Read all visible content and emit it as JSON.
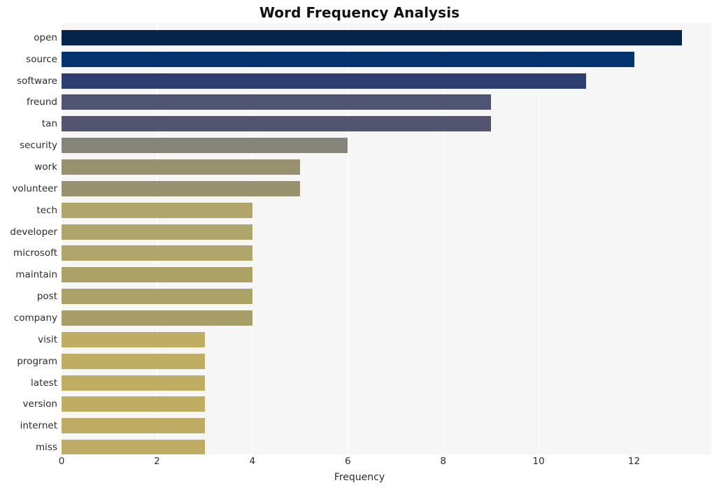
{
  "chart_data": {
    "type": "bar",
    "orientation": "horizontal",
    "title": "Word Frequency Analysis",
    "xlabel": "Frequency",
    "ylabel": "",
    "categories": [
      "open",
      "source",
      "software",
      "freund",
      "tan",
      "security",
      "work",
      "volunteer",
      "tech",
      "developer",
      "microsoft",
      "maintain",
      "post",
      "company",
      "visit",
      "program",
      "latest",
      "version",
      "internet",
      "miss"
    ],
    "values": [
      13,
      12,
      11,
      9,
      9,
      6,
      5,
      5,
      4,
      4,
      4,
      4,
      4,
      4,
      3,
      3,
      3,
      3,
      3,
      3
    ],
    "bar_colors": [
      "#042449",
      "#023370",
      "#2c3f70",
      "#4f5471",
      "#525470",
      "#868379",
      "#97916f",
      "#98926f",
      "#b0a56a",
      "#b0a56a",
      "#b0a56a",
      "#aca268",
      "#aca268",
      "#a89e68",
      "#bfad64",
      "#bfad64",
      "#bfad64",
      "#bfad64",
      "#bfac64",
      "#bfab63"
    ],
    "xticks": [
      0,
      2,
      4,
      6,
      8,
      10,
      12
    ],
    "xtick_labels": [
      "0",
      "2",
      "4",
      "6",
      "8",
      "10",
      "12"
    ],
    "xlim": [
      0,
      13.62
    ],
    "gridlines": true,
    "grid_color": "#ffffff",
    "plot_background": "#f6f6f7",
    "figure_background": "#ffffff",
    "legend": null
  }
}
